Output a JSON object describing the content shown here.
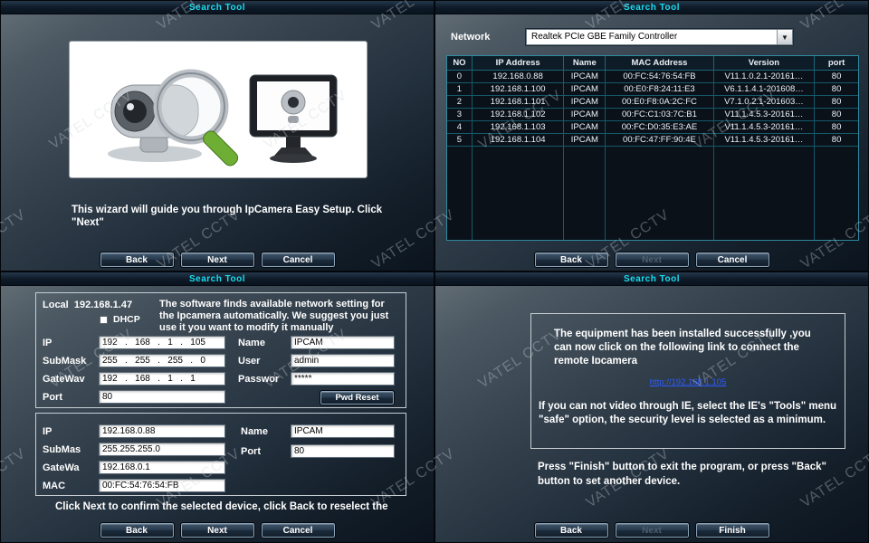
{
  "watermark": "VATEL CCTV",
  "window_title": "Search Tool",
  "buttons": {
    "back": "Back",
    "next": "Next",
    "cancel": "Cancel",
    "finish": "Finish",
    "pwd_reset": "Pwd Reset"
  },
  "wizard": {
    "description": "This wizard will guide you through IpCamera Easy Setup. Click \"Next\""
  },
  "search": {
    "network_label": "Network",
    "network_value": "Realtek PCIe GBE Family Controller",
    "headers": [
      "NO",
      "IP Address",
      "Name",
      "MAC Address",
      "Version",
      "port"
    ],
    "rows": [
      [
        "0",
        "192.168.0.88",
        "IPCAM",
        "00:FC:54:76:54:FB",
        "V11.1.0.2.1-20161…",
        "80"
      ],
      [
        "1",
        "192.168.1.100",
        "IPCAM",
        "00:E0:F8:24:11:E3",
        "V6.1.1.4.1-201608…",
        "80"
      ],
      [
        "2",
        "192.168.1.101",
        "IPCAM",
        "00:E0:F8:0A:2C:FC",
        "V7.1.0.2.1-201603…",
        "80"
      ],
      [
        "3",
        "192.168.1.102",
        "IPCAM",
        "00:FC:C1:03:7C:B1",
        "V11.1.4.5.3-20161…",
        "80"
      ],
      [
        "4",
        "192.168.1.103",
        "IPCAM",
        "00:FC:D0:35:E3:AE",
        "V11.1.4.5.3-20161…",
        "80"
      ],
      [
        "5",
        "192.168.1.104",
        "IPCAM",
        "00:FC:47:FF:90:4E",
        "V11.1.4.5.3-20161…",
        "80"
      ]
    ]
  },
  "config": {
    "local_label": "Local",
    "local_ip": "192.168.1.47",
    "dhcp_label": "DHCP",
    "description": "The software finds available network setting for the Ipcamera automatically. We suggest you just use it you want to modify it manually",
    "group1": {
      "ip_label": "IP",
      "ip_value": "192   .   168   .   1   .   105",
      "submask_label": "SubMask",
      "submask_value": "255   .   255   .   255   .   0",
      "gateway_label": "GateWav",
      "gateway_value": "192   .   168   .   1   .   1",
      "port_label": "Port",
      "port_value": "80",
      "name_label": "Name",
      "name_value": "IPCAM",
      "user_label": "User",
      "user_value": "admin",
      "password_label": "Passwor",
      "password_value": "*****"
    },
    "group2": {
      "ip_label": "IP",
      "ip_value": "192.168.0.88",
      "submask_label": "SubMas",
      "submask_value": "255.255.255.0",
      "gateway_label": "GateWa",
      "gateway_value": "192.168.0.1",
      "mac_label": "MAC",
      "mac_value": "00:FC:54:76:54:FB",
      "name_label": "Name",
      "name_value": "IPCAM",
      "port_label": "Port",
      "port_value": "80"
    },
    "footer_note": "Click Next to confirm the selected device, click Back to reselect the"
  },
  "finish": {
    "success_text": "The equipment has been installed successfully ,you can now click on the following link to connect the remote Ipcamera",
    "link": "http://192.168.1.105",
    "ie_note": "If you can not video through IE, select the IE's \"Tools\" menu \"safe\" option, the security level is selected as a minimum.",
    "exit_note": "Press \"Finish\" button to exit the program, or press \"Back\" button to set another device."
  }
}
